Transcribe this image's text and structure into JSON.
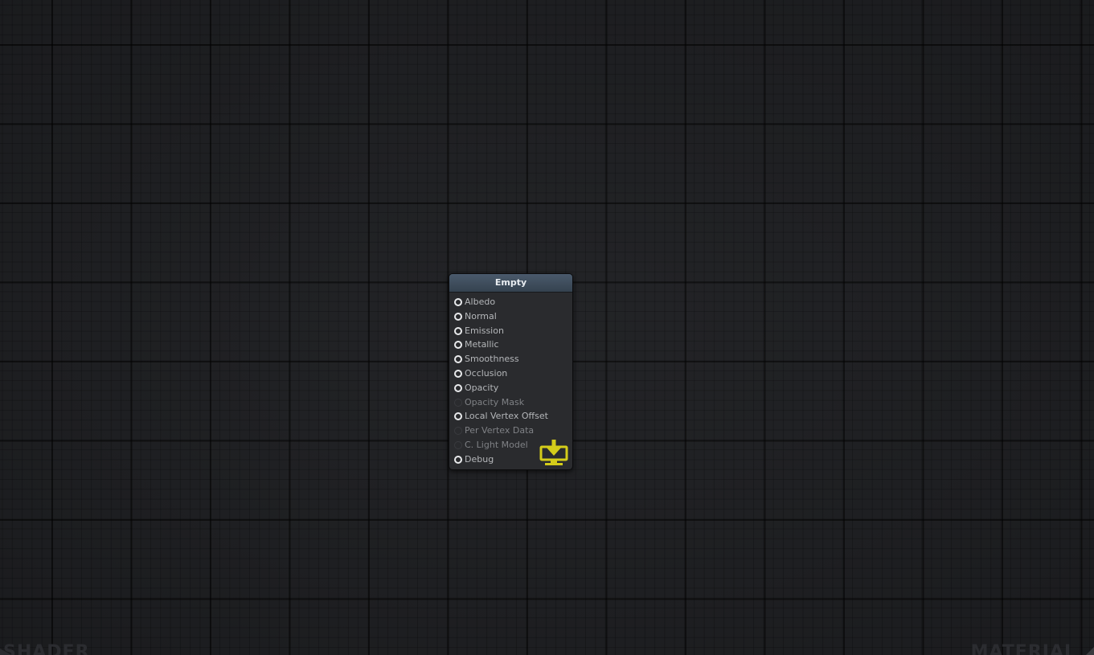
{
  "node": {
    "title": "Empty",
    "ports": [
      {
        "label": "Albedo",
        "active": true
      },
      {
        "label": "Normal",
        "active": true
      },
      {
        "label": "Emission",
        "active": true
      },
      {
        "label": "Metallic",
        "active": true
      },
      {
        "label": "Smoothness",
        "active": true
      },
      {
        "label": "Occlusion",
        "active": true
      },
      {
        "label": "Opacity",
        "active": true
      },
      {
        "label": "Opacity Mask",
        "active": false
      },
      {
        "label": "Local Vertex Offset",
        "active": true
      },
      {
        "label": "Per Vertex Data",
        "active": false
      },
      {
        "label": "C. Light Model",
        "active": false
      },
      {
        "label": "Debug",
        "active": true
      }
    ],
    "output_icon": "download-monitor-icon",
    "output_icon_color": "#d4cc1a"
  },
  "corners": {
    "left_label": "SHADER",
    "right_label": "MATERIAL"
  },
  "colors": {
    "canvas_bg": "#1e1f22",
    "node_bg": "#2a2b2e",
    "header_bg": "#3d4b5a",
    "socket_active": "#e9eaec",
    "accent": "#d4cc1a"
  }
}
